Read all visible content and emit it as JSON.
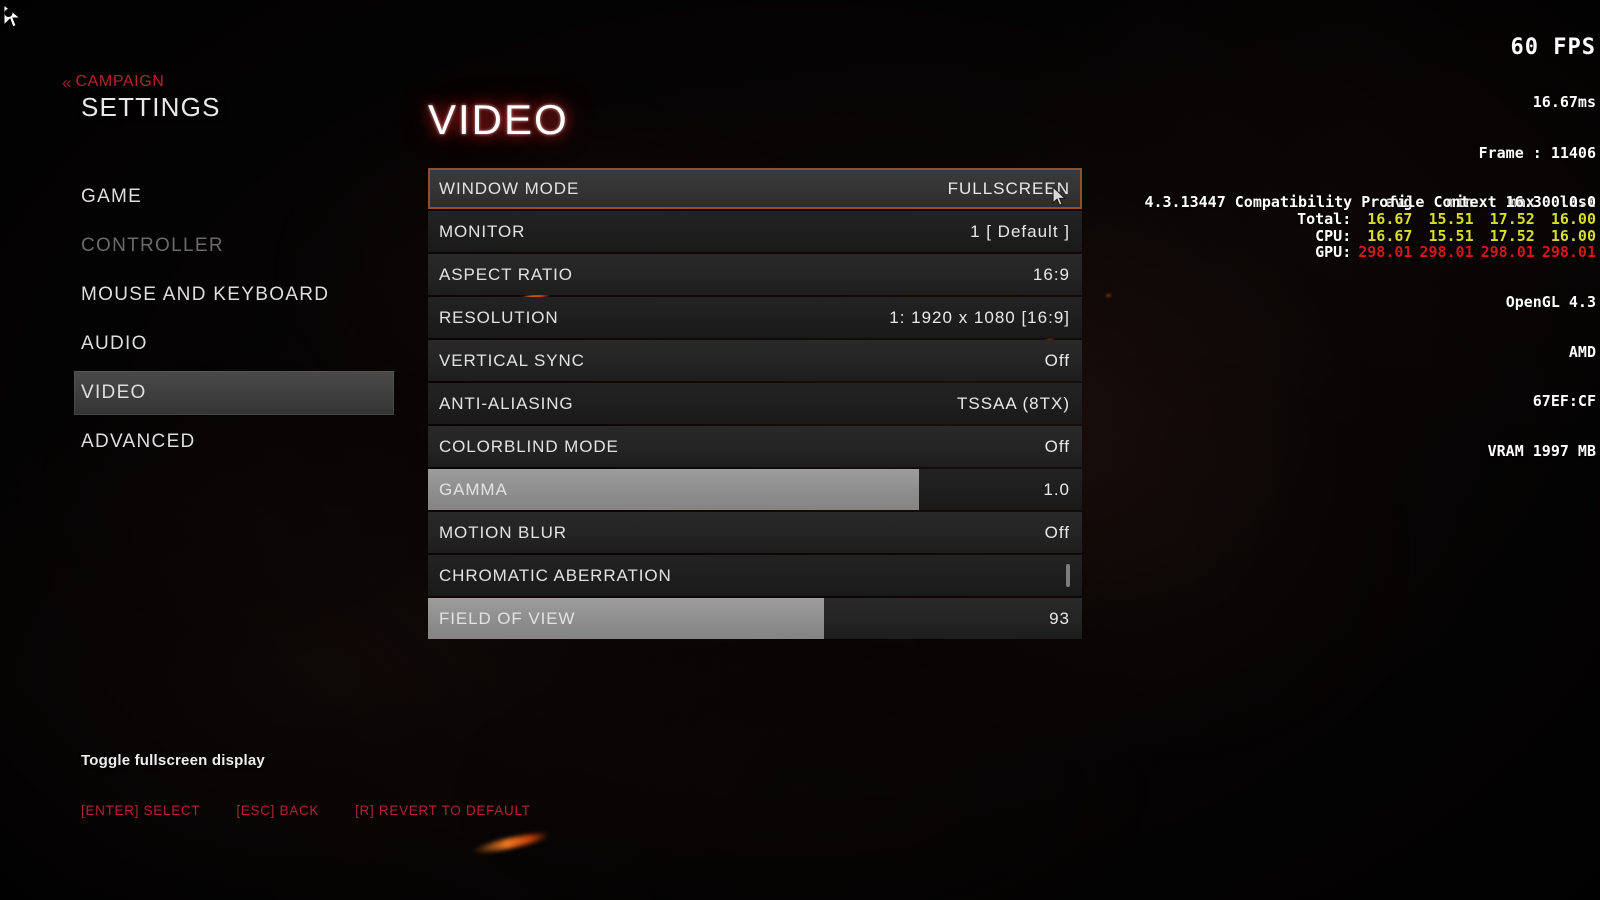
{
  "back_nav": {
    "icon": "double-chevron-left-icon",
    "label": "CAMPAIGN",
    "glyph": "«"
  },
  "header": {
    "title": "SETTINGS"
  },
  "sidebar": {
    "items": [
      {
        "label": "GAME",
        "state": "normal"
      },
      {
        "label": "CONTROLLER",
        "state": "disabled"
      },
      {
        "label": "MOUSE AND KEYBOARD",
        "state": "normal"
      },
      {
        "label": "AUDIO",
        "state": "normal"
      },
      {
        "label": "VIDEO",
        "state": "active"
      },
      {
        "label": "ADVANCED",
        "state": "normal"
      }
    ]
  },
  "panel": {
    "title": "VIDEO",
    "rows": [
      {
        "name": "WINDOW MODE",
        "value": "FULLSCREEN",
        "kind": "value",
        "selected": true
      },
      {
        "name": "MONITOR",
        "value": "1 [ Default ]",
        "kind": "value",
        "selected": false
      },
      {
        "name": "ASPECT RATIO",
        "value": "16:9",
        "kind": "value",
        "selected": false
      },
      {
        "name": "RESOLUTION",
        "value": "1: 1920 x 1080 [16:9]",
        "kind": "value",
        "selected": false
      },
      {
        "name": "VERTICAL SYNC",
        "value": "Off",
        "kind": "value",
        "selected": false
      },
      {
        "name": "ANTI-ALIASING",
        "value": "TSSAA (8TX)",
        "kind": "value",
        "selected": false
      },
      {
        "name": "COLORBLIND MODE",
        "value": "Off",
        "kind": "value",
        "selected": false
      },
      {
        "name": "GAMMA",
        "value": "1.0",
        "kind": "slider",
        "fill_percent": 75,
        "selected": false
      },
      {
        "name": "MOTION BLUR",
        "value": "Off",
        "kind": "value",
        "selected": false
      },
      {
        "name": "CHROMATIC ABERRATION",
        "value": "",
        "kind": "checkbox",
        "checked": false,
        "selected": false
      },
      {
        "name": "FIELD OF VIEW",
        "value": "93",
        "kind": "slider",
        "fill_percent": 60.5,
        "selected": false
      }
    ]
  },
  "hint": {
    "text": "Toggle fullscreen display"
  },
  "footer": {
    "actions": [
      {
        "label": "[ENTER] SELECT"
      },
      {
        "label": "[ESC] BACK"
      },
      {
        "label": "[R] REVERT TO DEFAULT"
      }
    ]
  },
  "perf_overlay": {
    "fps": "60 FPS",
    "frametime": "16.67ms",
    "frame": "Frame : 11406",
    "columns": [
      "avg",
      "min",
      "max",
      "last"
    ],
    "rows": [
      {
        "label": "Total:",
        "values": [
          "16.67",
          "15.51",
          "17.52",
          "16.00"
        ],
        "color": "#d8dc2c"
      },
      {
        "label": "CPU:",
        "values": [
          "16.67",
          "15.51",
          "17.52",
          "16.00"
        ],
        "color": "#d8dc2c"
      },
      {
        "label": "GPU:",
        "values": [
          "298.01",
          "298.01",
          "298.01",
          "298.01"
        ],
        "color": "#cf1a1a"
      }
    ],
    "api": "OpenGL 4.3",
    "vendor": "AMD",
    "device_id": "67EF:CF",
    "vram": "VRAM 1997 MB",
    "context": "4.3.13447 Compatibility Profile Context 16.300.0.0"
  },
  "colors": {
    "accent_red": "#b02433",
    "selection_border": "#9c4b22",
    "ember_orange": "#ff8223",
    "perf_yellow": "#d8dc2c",
    "perf_red": "#cf1a1a"
  }
}
